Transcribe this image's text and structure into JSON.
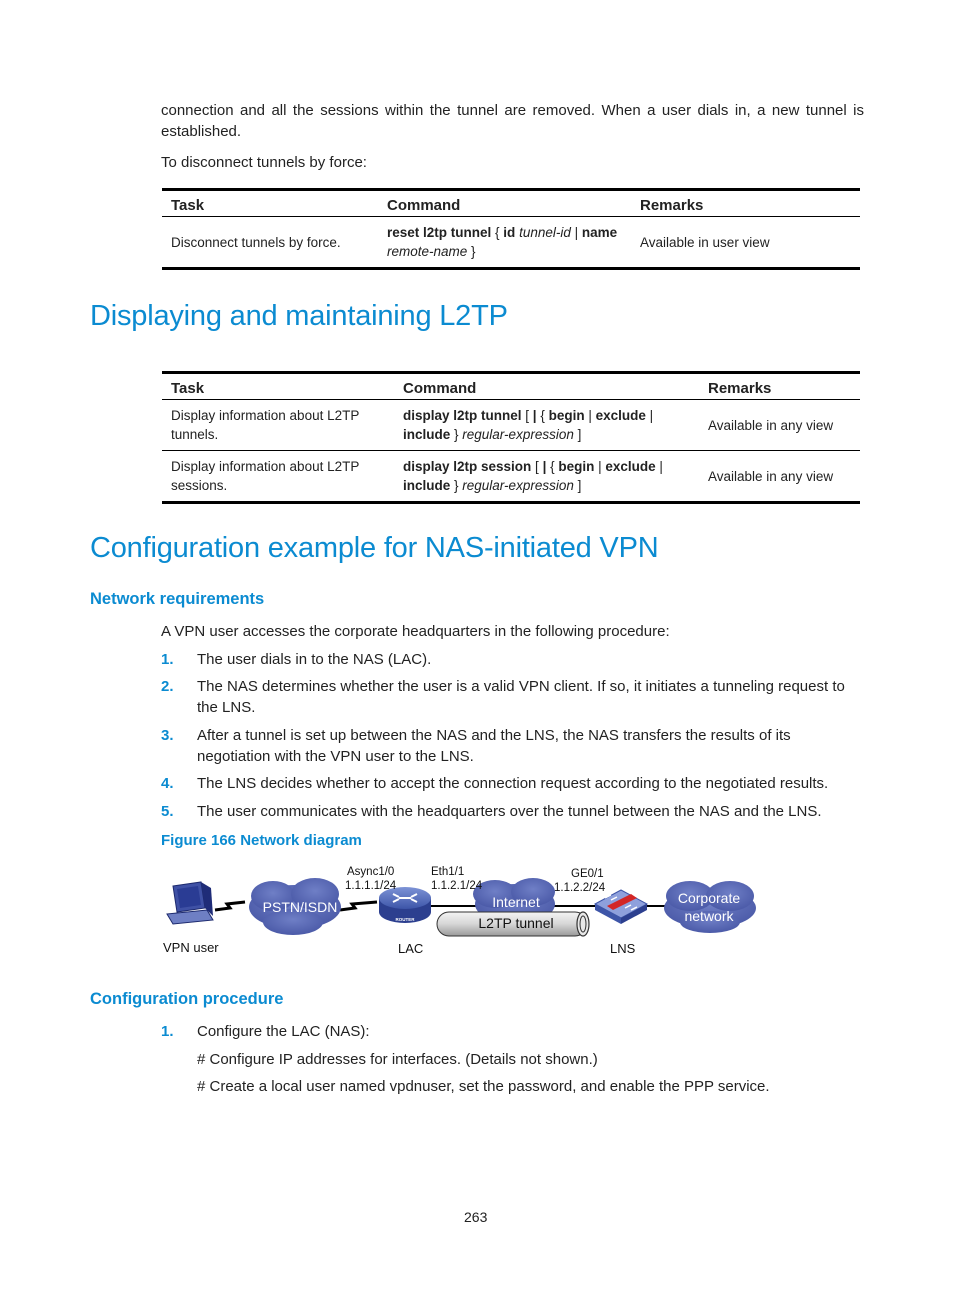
{
  "intro": {
    "paragraph": "connection and all the sessions within the tunnel are removed. When a user dials in, a new tunnel is established.",
    "lead": "To disconnect tunnels by force:"
  },
  "table1": {
    "headers": [
      "Task",
      "Command",
      "Remarks"
    ],
    "rows": [
      {
        "task": "Disconnect tunnels by force.",
        "command": [
          {
            "t": "reset l2tp tunnel",
            "s": "b"
          },
          {
            "t": " { ",
            "s": ""
          },
          {
            "t": "id",
            "s": "b"
          },
          {
            "t": " ",
            "s": ""
          },
          {
            "t": "tunnel-id",
            "s": "i"
          },
          {
            "t": " | ",
            "s": ""
          },
          {
            "t": "name",
            "s": "b"
          },
          {
            "t": " ",
            "s": ""
          },
          {
            "t": "remote-name",
            "s": "i"
          },
          {
            "t": " }",
            "s": ""
          }
        ],
        "remarks": "Available in user view"
      }
    ]
  },
  "section1": {
    "title": "Displaying and maintaining L2TP"
  },
  "table2": {
    "headers": [
      "Task",
      "Command",
      "Remarks"
    ],
    "rows": [
      {
        "task": "Display information about L2TP tunnels.",
        "command": [
          {
            "t": "display l2tp tunnel",
            "s": "b"
          },
          {
            "t": " [ ",
            "s": ""
          },
          {
            "t": "|",
            "s": "b"
          },
          {
            "t": " { ",
            "s": ""
          },
          {
            "t": "begin",
            "s": "b"
          },
          {
            "t": " | ",
            "s": ""
          },
          {
            "t": "exclude",
            "s": "b"
          },
          {
            "t": " | ",
            "s": ""
          },
          {
            "t": "include",
            "s": "b"
          },
          {
            "t": " } ",
            "s": ""
          },
          {
            "t": "regular-expression",
            "s": "i"
          },
          {
            "t": " ]",
            "s": ""
          }
        ],
        "remarks": "Available in any view"
      },
      {
        "task": "Display information about L2TP sessions.",
        "command": [
          {
            "t": "display l2tp session",
            "s": "b"
          },
          {
            "t": " [ ",
            "s": ""
          },
          {
            "t": "|",
            "s": "b"
          },
          {
            "t": " { ",
            "s": ""
          },
          {
            "t": "begin",
            "s": "b"
          },
          {
            "t": " | ",
            "s": ""
          },
          {
            "t": "exclude",
            "s": "b"
          },
          {
            "t": " | ",
            "s": ""
          },
          {
            "t": "include",
            "s": "b"
          },
          {
            "t": " } ",
            "s": ""
          },
          {
            "t": "regular-expression",
            "s": "i"
          },
          {
            "t": " ]",
            "s": ""
          }
        ],
        "remarks": "Available in any view"
      }
    ]
  },
  "section2": {
    "title": "Configuration example for NAS-initiated VPN",
    "subsection1": {
      "title": "Network requirements",
      "lead": "A VPN user accesses the corporate headquarters in the following procedure:",
      "steps": [
        {
          "num": "1.",
          "text": "The user dials in to the NAS (LAC)."
        },
        {
          "num": "2.",
          "text": "The NAS determines whether the user is a valid VPN client. If so, it initiates a tunneling request to the LNS."
        },
        {
          "num": "3.",
          "text": "After a tunnel is set up between the NAS and the LNS, the NAS transfers the results of its negotiation with the VPN user to the LNS."
        },
        {
          "num": "4.",
          "text": "The LNS decides whether to accept the connection request according to the negotiated results."
        },
        {
          "num": "5.",
          "text": "The user communicates with the headquarters over the tunnel between the NAS and the LNS."
        }
      ]
    },
    "figure": {
      "caption": "Figure 166 Network diagram",
      "labels": {
        "async_if": "Async1/0",
        "async_ip": "1.1.1.1/24",
        "eth_if": "Eth1/1",
        "eth_ip": "1.1.2.1/24",
        "ge_if": "GE0/1",
        "ge_ip": "1.1.2.2/24",
        "pstn": "PSTN/ISDN",
        "internet": "Internet",
        "tunnel": "L2TP tunnel",
        "corporate_line1": "Corporate",
        "corporate_line2": "network",
        "vpn_user": "VPN user",
        "lac": "LAC",
        "lns": "LNS",
        "router_badge": "ROUTER"
      }
    },
    "subsection2": {
      "title": "Configuration procedure",
      "steps": [
        {
          "num": "1.",
          "text": "Configure the LAC (NAS):"
        }
      ],
      "notes": [
        "# Configure IP addresses for interfaces. (Details not shown.)",
        "# Create a local user named vpdnuser, set the password, and enable the PPP service."
      ]
    }
  },
  "footer": {
    "page_number": "263"
  }
}
